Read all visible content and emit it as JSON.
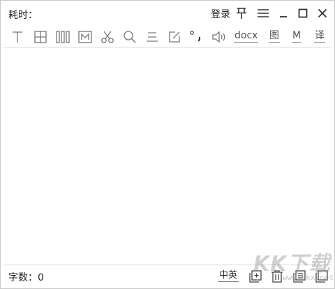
{
  "titlebar": {
    "elapsed_label": "耗时：",
    "login_label": "登录"
  },
  "toolbar": {
    "docx_label": "docx",
    "image_label": "图",
    "m_label": "M",
    "translate_label": "译"
  },
  "statusbar": {
    "word_count": "字数：0",
    "language_toggle": "中英"
  },
  "watermark": {
    "text": "KK下载",
    "url": "www.kkx.net"
  },
  "colors": {
    "icon": "#666666",
    "separator": "#d6d6d6",
    "border": "#c8c8c8"
  }
}
